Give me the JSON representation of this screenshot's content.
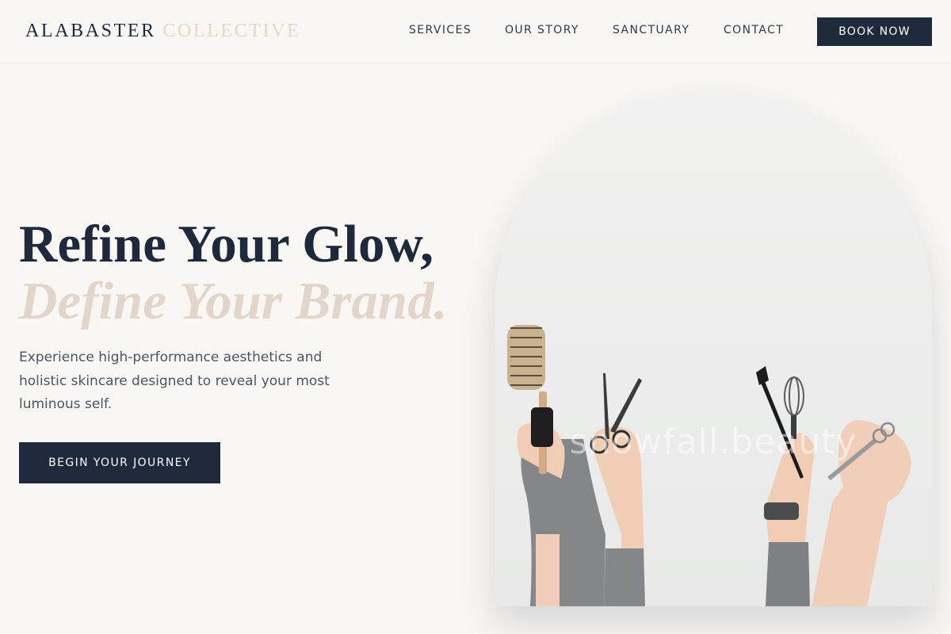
{
  "header": {
    "logo": {
      "word1": "ALABASTER",
      "word2": "COLLECTIVE"
    },
    "nav": [
      {
        "label": "SERVICES"
      },
      {
        "label": "OUR STORY"
      },
      {
        "label": "SANCTUARY"
      },
      {
        "label": "CONTACT"
      }
    ],
    "book_button": "BOOK NOW"
  },
  "hero": {
    "headline_line1": "Refine Your Glow,",
    "headline_line2": "Define Your Brand.",
    "body": "Experience high-performance aesthetics and holistic skincare designed to reveal your most luminous self.",
    "cta": "BEGIN YOUR JOURNEY"
  },
  "hero_image": {
    "watermark": "snowfall.beauty",
    "subject_icons": [
      "round-brush-icon",
      "scissors-icon",
      "tint-brush-icon",
      "whisk-icon",
      "shears-icon"
    ]
  },
  "colors": {
    "background": "#f9f7f4",
    "navy": "#1e2a3c",
    "accent_beige": "#e2d6ca",
    "body_text": "#4a5568"
  }
}
